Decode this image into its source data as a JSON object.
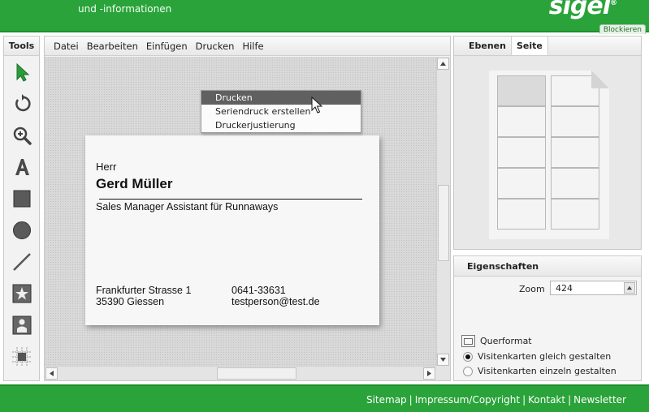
{
  "header": {
    "tagline": "und -informationen",
    "logo": "sigel",
    "block_button": "Blockieren"
  },
  "tools": {
    "title": "Tools",
    "items": [
      "select-arrow-icon",
      "rotate-icon",
      "zoom-icon",
      "text-icon",
      "rectangle-icon",
      "circle-icon",
      "line-icon",
      "clipart-icon",
      "image-icon",
      "grid-icon"
    ]
  },
  "menu": {
    "items": [
      "Datei",
      "Bearbeiten",
      "Einfügen",
      "Drucken",
      "Hilfe"
    ],
    "dropdown": [
      "Drucken",
      "Seriendruck erstellen",
      "Druckerjustierung"
    ]
  },
  "card": {
    "salutation": "Herr",
    "name": "Gerd Müller",
    "role": "Sales Manager Assistant für Runnaways",
    "street": "Frankfurter Strasse 1",
    "city": "35390 Giessen",
    "phone": "0641-33631",
    "email": "testperson@test.de"
  },
  "pages_panel": {
    "tabs": [
      "Ebenen",
      "Seite"
    ],
    "active_tab": "Seite"
  },
  "properties": {
    "title": "Eigenschaften",
    "zoom_label": "Zoom",
    "zoom_value": "424",
    "landscape_label": "Querformat",
    "option_same": "Visitenkarten gleich gestalten",
    "option_individual": "Visitenkarten einzeln gestalten"
  },
  "footer": {
    "links": [
      "Sitemap",
      "Impressum/Copyright",
      "Kontakt",
      "Newsletter"
    ]
  },
  "colors": {
    "brand_green": "#2aa33a",
    "tool_green": "#2a9d3a"
  }
}
